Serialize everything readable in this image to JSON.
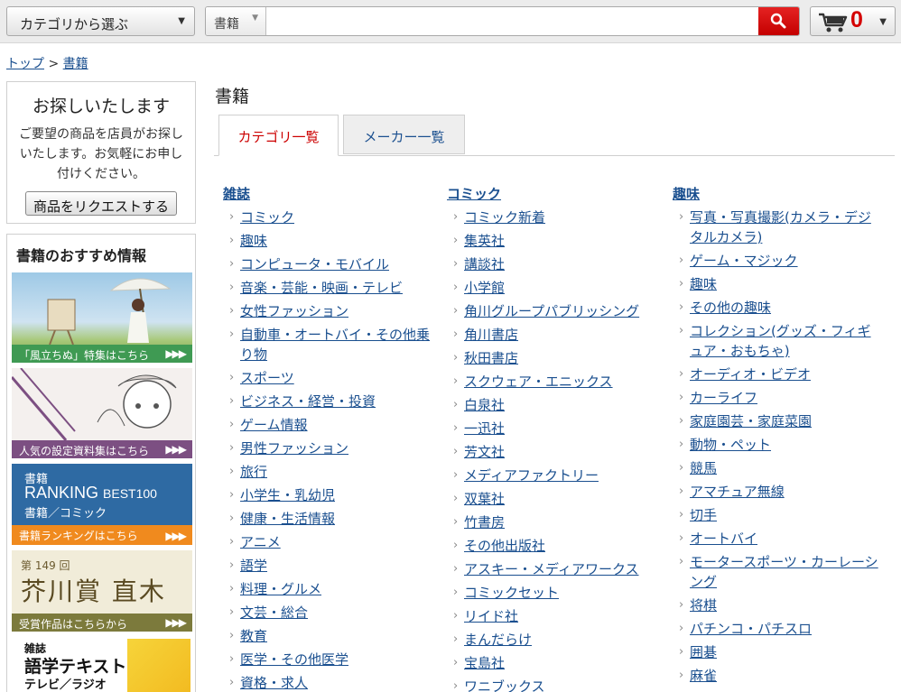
{
  "header": {
    "category_select": "カテゴリから選ぶ",
    "search_scope": "書籍",
    "search_value": "",
    "cart_count": "0"
  },
  "breadcrumb": {
    "home": "トップ",
    "separator": ">",
    "current": "書籍"
  },
  "request_box": {
    "title": "お探しいたします",
    "body": "ご要望の商品を店員がお探しいたします。お気軽にお申し付けください。",
    "button": "商品をリクエストする"
  },
  "recommend": {
    "title": "書籍のおすすめ情報",
    "banners": [
      {
        "caption": "「風立ちぬ」特集はこちら",
        "more": "▶▶▶"
      },
      {
        "caption": "人気の設定資料集はこちら",
        "more": "▶▶▶"
      },
      {
        "line1": "書籍",
        "line2": "RANKING",
        "line2b": "BEST100",
        "line3": "書籍／コミック",
        "caption": "書籍ランキングはこちら",
        "more": "▶▶▶"
      },
      {
        "line1": "第 149 回",
        "line2": "芥川賞 直木賞",
        "caption": "受賞作品はこちらから",
        "more": "▶▶▶"
      },
      {
        "line1": "雑誌",
        "line2": "語学テキスト",
        "line3": "テレビ／ラジオ"
      }
    ]
  },
  "main": {
    "title": "書籍",
    "tabs": [
      {
        "label": "カテゴリ一覧",
        "active": true
      },
      {
        "label": "メーカー一覧",
        "active": false
      }
    ],
    "columns": [
      {
        "heading": "雑誌",
        "items": [
          "コミック",
          "趣味",
          "コンピュータ・モバイル",
          "音楽・芸能・映画・テレビ",
          "女性ファッション",
          "自動車・オートバイ・その他乗り物",
          "スポーツ",
          "ビジネス・経営・投資",
          "ゲーム情報",
          "男性ファッション",
          "旅行",
          "小学生・乳幼児",
          "健康・生活情報",
          "アニメ",
          "語学",
          "料理・グルメ",
          "文芸・総合",
          "教育",
          "医学・その他医学",
          "資格・求人"
        ]
      },
      {
        "heading": "コミック",
        "items": [
          "コミック新着",
          "集英社",
          "講談社",
          "小学館",
          "角川グループパブリッシング",
          "角川書店",
          "秋田書店",
          "スクウェア・エニックス",
          "白泉社",
          "一迅社",
          "芳文社",
          "メディアファクトリー",
          "双葉社",
          "竹書房",
          "その他出版社",
          "アスキー・メディアワークス",
          "コミックセット",
          "リイド社",
          "まんだらけ",
          "宝島社",
          "ワニブックス"
        ]
      },
      {
        "heading": "趣味",
        "items": [
          "写真・写真撮影(カメラ・デジタルカメラ)",
          "ゲーム・マジック",
          "趣味",
          "その他の趣味",
          "コレクション(グッズ・フィギュア・おもちゃ)",
          "オーディオ・ビデオ",
          "カーライフ",
          "家庭園芸・家庭菜園",
          "動物・ペット",
          "競馬",
          "アマチュア無線",
          "切手",
          "オートバイ",
          "モータースポーツ・カーレーシング",
          "将棋",
          "パチンコ・パチスロ",
          "囲碁",
          "麻雀"
        ]
      }
    ]
  },
  "colors": {
    "link": "#1a4f8f",
    "active_tab": "#cc0000",
    "search_button": "#d10000",
    "cart_count": "#d40000"
  }
}
